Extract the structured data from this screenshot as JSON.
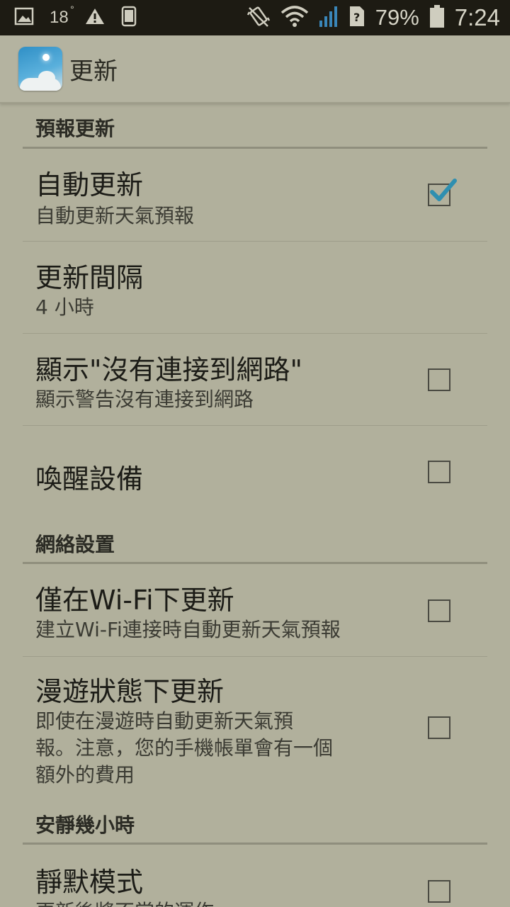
{
  "status_bar": {
    "temperature": "18",
    "temperature_unit": "°",
    "battery_percent": "79%",
    "time": "7:24",
    "icons": [
      "image-icon",
      "warning-icon",
      "phone-icon",
      "vibrate-icon",
      "wifi-icon",
      "signal-icon",
      "sim-unknown-icon",
      "battery-icon"
    ]
  },
  "action_bar": {
    "app_icon": "weather-app-icon",
    "title": "更新"
  },
  "sections": {
    "forecast_update": {
      "header": "預報更新",
      "auto_update": {
        "title": "自動更新",
        "summary": "自動更新天氣預報",
        "checked": true
      },
      "update_interval": {
        "title": "更新間隔",
        "summary": "4 小時"
      },
      "show_no_connection": {
        "title": "顯示\"沒有連接到網路\"",
        "summary": "顯示警告沒有連接到網路",
        "checked": false
      },
      "wake_device": {
        "title": "喚醒設備",
        "checked": false
      }
    },
    "network_settings": {
      "header": "網絡設置",
      "wifi_only": {
        "title": "僅在Wi-Fi下更新",
        "summary": "建立Wi-Fi連接時自動更新天氣預報",
        "checked": false
      },
      "roaming": {
        "title": "漫遊狀態下更新",
        "summary_line1": "即使在漫遊時自動更新天氣預",
        "summary_line2": "報。注意，您的手機帳單會有一個",
        "summary_line3": "額外的費用",
        "checked": false
      }
    },
    "quiet_hours": {
      "header": "安靜幾小時",
      "silent_mode": {
        "title": "靜默模式",
        "summary": "更新後將不當的運作",
        "checked": false
      }
    }
  },
  "colors": {
    "background": "#b1b09c",
    "status_bar": "#1d1b13",
    "checkmark": "#2f8fb0"
  }
}
